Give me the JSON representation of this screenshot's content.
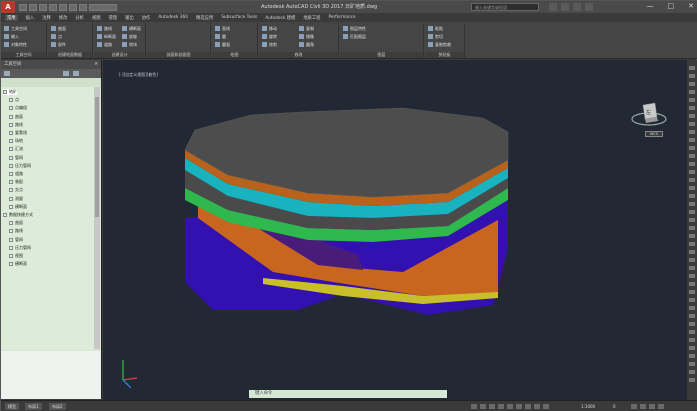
{
  "app": {
    "logo_letter": "A",
    "window_title": "Autodesk AutoCAD Civil 3D 2017   日矿地质.dwg",
    "search_placeholder": "键入关键字或短语",
    "window_controls": [
      "—",
      "□",
      "✕"
    ]
  },
  "ribbon": {
    "tabs": [
      "常用",
      "插入",
      "注释",
      "修改",
      "分析",
      "视图",
      "管理",
      "输出",
      "协作",
      "Autodesk 360",
      "精选应用",
      "Subsurface Tools",
      "Autodesk 建模",
      "地质工程",
      "Performance"
    ],
    "active_tab": 0,
    "panels": [
      {
        "label": "工具空间"
      },
      {
        "label": "创建地面数据"
      },
      {
        "label": "创建设计"
      },
      {
        "label": "剖面和剖面图"
      },
      {
        "label": "绘图"
      },
      {
        "label": "修改"
      },
      {
        "label": "图层"
      },
      {
        "label": "剪贴板"
      }
    ],
    "buttons": [
      "工具空间",
      "输入",
      "对象特性",
      "曲面",
      "点",
      "部件",
      "路线",
      "纵断面",
      "道路",
      "横断面",
      "放坡",
      "地块",
      "直线",
      "圆",
      "圆弧",
      "移动",
      "旋转",
      "修剪",
      "复制",
      "镜像",
      "圆角",
      "图层特性",
      "匹配图层",
      "粘贴",
      "剪切",
      "复制剪裁"
    ]
  },
  "toolspace": {
    "title": "工具空间",
    "tree": [
      {
        "label": "地矿"
      },
      {
        "label": "点"
      },
      {
        "label": "点编组"
      },
      {
        "label": "曲面"
      },
      {
        "label": "路线"
      },
      {
        "label": "要素线"
      },
      {
        "label": "场地"
      },
      {
        "label": "汇流"
      },
      {
        "label": "管网"
      },
      {
        "label": "压力管网"
      },
      {
        "label": "道路"
      },
      {
        "label": "装配"
      },
      {
        "label": "交点"
      },
      {
        "label": "测量"
      },
      {
        "label": "横断面"
      },
      {
        "label": "数据快捷方式"
      },
      {
        "label": "曲面"
      },
      {
        "label": "路线"
      },
      {
        "label": "管网"
      },
      {
        "label": "压力管网"
      },
      {
        "label": "视图"
      },
      {
        "label": "横断面"
      }
    ]
  },
  "viewport": {
    "label": "[-][自定义视图][着色]",
    "viewcube_face": "左",
    "wcs_label": "WCS"
  },
  "statusbar": {
    "tabs": [
      "模型",
      "布局1",
      "布局2"
    ],
    "command_placeholder": "键入命令",
    "scale": "1:1000",
    "elevation": "0"
  },
  "colors": {
    "top_surface": "#4d4d4d",
    "cyan_layer": "#19b3bf",
    "green_layer": "#2eb84d",
    "orange_layer": "#c8651f",
    "yellow_layer": "#c9bf2a",
    "purple_layer": "#3d1a7a",
    "blue_body": "#3310b0",
    "viewport_bg": "#222834"
  }
}
